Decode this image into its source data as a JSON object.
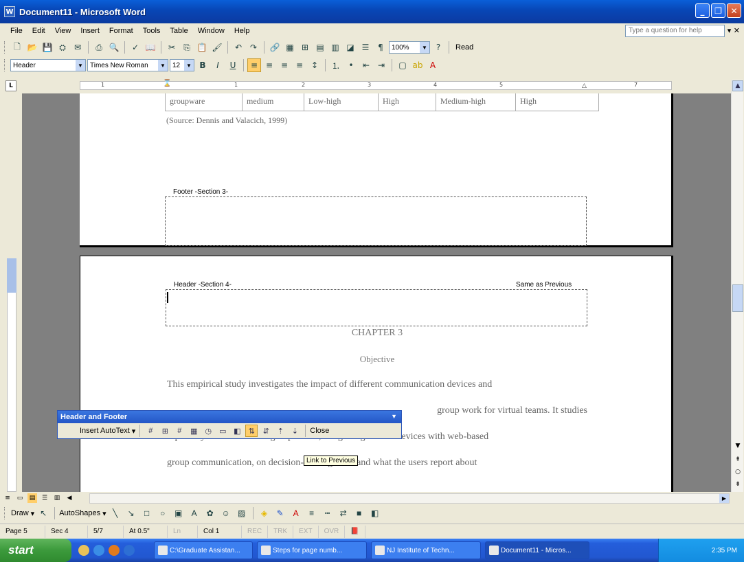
{
  "window": {
    "title": "Document11 - Microsoft Word",
    "icon_letter": "W"
  },
  "menu": {
    "items": [
      "File",
      "Edit",
      "View",
      "Insert",
      "Format",
      "Tools",
      "Table",
      "Window",
      "Help"
    ],
    "help_placeholder": "Type a question for help"
  },
  "toolbar": {
    "zoom": "100%",
    "read_label": "Read"
  },
  "formatting": {
    "style": "Header",
    "font": "Times New Roman",
    "size": "12"
  },
  "ruler": {
    "marks": [
      "1",
      "1",
      "2",
      "3",
      "4",
      "5",
      "7"
    ]
  },
  "document": {
    "table_remnant": [
      "groupware",
      "medium",
      "Low-high",
      "High",
      "Medium-high",
      "High"
    ],
    "source_line": "(Source: Dennis and Valacich, 1999)",
    "footer_label": "Footer -Section 3-",
    "header_label": "Header -Section 4-",
    "same_as_previous": "Same as Previous",
    "chapter": "CHAPTER 3",
    "objective": "Objective",
    "paragraph_lines": [
      "This empirical study investigates the impact of different communication devices and",
      "group work for virtual teams. It studies",
      "especially how distributed groups work, integrating mobile devices with web-based",
      "group communication, on decision-making tasks and what the users report about"
    ]
  },
  "hf_toolbar": {
    "title": "Header and Footer",
    "insert_autotext": "Insert AutoText",
    "close": "Close",
    "tooltip": "Link to Previous"
  },
  "drawbar": {
    "draw": "Draw",
    "autoshapes": "AutoShapes"
  },
  "status": {
    "page": "Page 5",
    "sec": "Sec 4",
    "pages": "5/7",
    "at": "At 0.5\"",
    "ln": "Ln",
    "col": "Col 1",
    "rec": "REC",
    "trk": "TRK",
    "ext": "EXT",
    "ovr": "OVR"
  },
  "taskbar": {
    "start": "start",
    "tasks": [
      "C:\\Graduate Assistan...",
      "Steps for page numb...",
      "NJ Institute of Techn...",
      "Document11 - Micros..."
    ],
    "clock": "2:35 PM"
  }
}
